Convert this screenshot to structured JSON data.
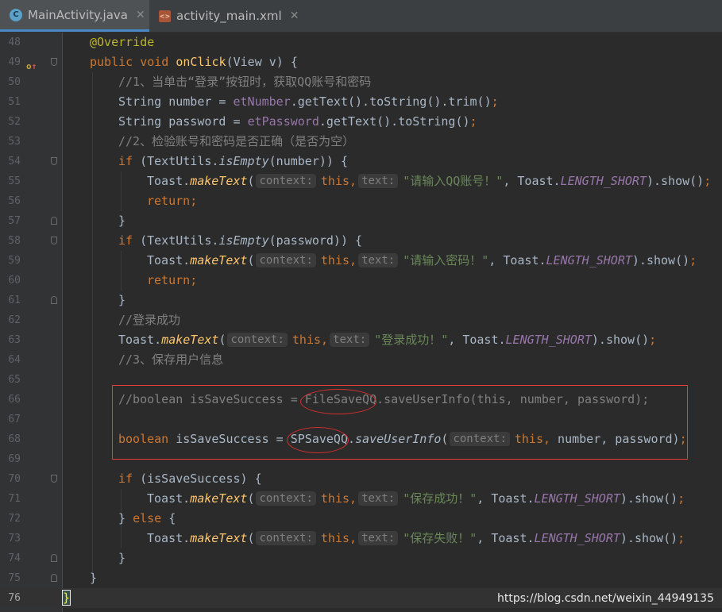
{
  "tabs": [
    {
      "label": "MainActivity.java",
      "icon": "java-class-icon",
      "active": true
    },
    {
      "label": "activity_main.xml",
      "icon": "xml-file-icon",
      "active": false
    }
  ],
  "gutter": {
    "line_numbers": [
      "48",
      "49",
      "50",
      "51",
      "52",
      "53",
      "54",
      "55",
      "56",
      "57",
      "58",
      "59",
      "60",
      "61",
      "62",
      "63",
      "64",
      "65",
      "66",
      "67",
      "68",
      "69",
      "70",
      "71",
      "72",
      "73",
      "74",
      "75",
      "76"
    ],
    "override_marker": "o↑"
  },
  "code": {
    "l48": {
      "annotation": "@Override"
    },
    "l49": {
      "kw": "public void ",
      "fn": "onClick",
      "rest": "(View v) {"
    },
    "l50": {
      "comment": "//1、当单击“登录”按钮时，获取QQ账号和密码"
    },
    "l51": {
      "a": "String number = ",
      "fld": "etNumber",
      "b": ".getText().toString().trim()",
      ";": ";"
    },
    "l52": {
      "a": "String password = ",
      "fld": "etPassword",
      "b": ".getText().toString()",
      ";": ";"
    },
    "l53": {
      "comment": "//2、检验账号和密码是否正确（是否为空）"
    },
    "l54": {
      "kw": "if ",
      "a": "(TextUtils.",
      "m": "isEmpty",
      "b": "(number)) {"
    },
    "l55": {
      "a": "Toast.",
      "m": "makeText",
      "b": "(",
      "hint1": "context:",
      "this": "this,",
      "hint2": "text:",
      "str": "\"请输入QQ账号！\"",
      "c": ", Toast.",
      "const": "LENGTH_SHORT",
      "d": ").show()",
      ";": ";"
    },
    "l56": {
      "kw": "return",
      ";": ";"
    },
    "l57": {
      "a": "}"
    },
    "l58": {
      "kw": "if ",
      "a": "(TextUtils.",
      "m": "isEmpty",
      "b": "(password)) {"
    },
    "l59": {
      "a": "Toast.",
      "m": "makeText",
      "b": "(",
      "hint1": "context:",
      "this": "this,",
      "hint2": "text:",
      "str": "\"请输入密码！\"",
      "c": ", Toast.",
      "const": "LENGTH_SHORT",
      "d": ").show()",
      ";": ";"
    },
    "l60": {
      "kw": "return",
      ";": ";"
    },
    "l61": {
      "a": "}"
    },
    "l62": {
      "comment": "//登录成功"
    },
    "l63": {
      "a": "Toast.",
      "m": "makeText",
      "b": "(",
      "hint1": "context:",
      "this": "this,",
      "hint2": "text:",
      "str": "\"登录成功！\"",
      "c": ", Toast.",
      "const": "LENGTH_SHORT",
      "d": ").show()",
      ";": ";"
    },
    "l64": {
      "comment": "//3、保存用户信息"
    },
    "l66": {
      "comment": "//boolean isSaveSuccess = FileSaveQQ.saveUserInfo(this, number, password);"
    },
    "l68": {
      "kw": "boolean ",
      "a": "isSaveSuccess = SPSaveQQ.",
      "m": "saveUserInfo",
      "b": "(",
      "hint1": "context:",
      "this": "this,",
      "c": " number, password)",
      ";": ";"
    },
    "l70": {
      "kw": "if ",
      "a": "(isSaveSuccess) {"
    },
    "l71": {
      "a": "Toast.",
      "m": "makeText",
      "b": "(",
      "hint1": "context:",
      "this": "this,",
      "hint2": "text:",
      "str": "\"保存成功！\"",
      "c": ", Toast.",
      "const": "LENGTH_SHORT",
      "d": ").show()",
      ";": ";"
    },
    "l72": {
      "a": "} ",
      "kw": "else ",
      "b": "{"
    },
    "l73": {
      "a": "Toast.",
      "m": "makeText",
      "b": "(",
      "hint1": "context:",
      "this": "this,",
      "hint2": "text:",
      "str": "\"保存失败！\"",
      "c": ", Toast.",
      "const": "LENGTH_SHORT",
      "d": ").show()",
      ";": ";"
    },
    "l74": {
      "a": "}"
    },
    "l75": {
      "a": "}"
    },
    "l76": {
      "brace": "}"
    }
  },
  "watermark": "https://blog.csdn.net/weixin_44949135",
  "colors": {
    "keyword": "#cc7832",
    "string": "#6a8759",
    "comment": "#808080",
    "field": "#9876aa",
    "method": "#ffc66d",
    "annotation_box": "#e83b3b"
  }
}
